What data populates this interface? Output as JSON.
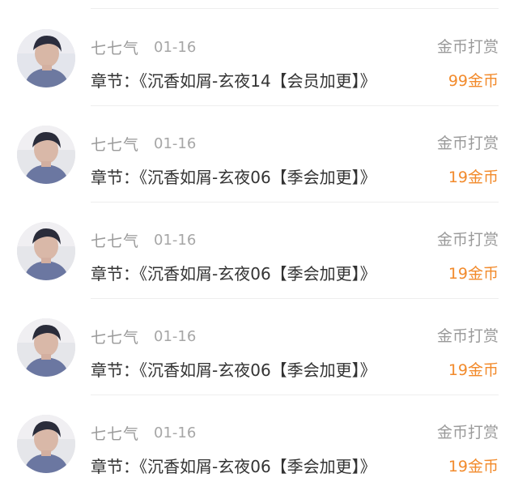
{
  "records": [
    {
      "user": "七七气",
      "date": "01-16",
      "type": "金币打赏",
      "chapter": "章节：《沉香如屑-玄夜14【会员加更】》",
      "amount": "99金币",
      "avatar_icon": "user-avatar-photo"
    },
    {
      "user": "七七气",
      "date": "01-16",
      "type": "金币打赏",
      "chapter": "章节：《沉香如屑-玄夜06【季会加更】》",
      "amount": "19金币",
      "avatar_icon": "user-avatar-photo"
    },
    {
      "user": "七七气",
      "date": "01-16",
      "type": "金币打赏",
      "chapter": "章节：《沉香如屑-玄夜06【季会加更】》",
      "amount": "19金币",
      "avatar_icon": "user-avatar-photo"
    },
    {
      "user": "七七气",
      "date": "01-16",
      "type": "金币打赏",
      "chapter": "章节：《沉香如屑-玄夜06【季会加更】》",
      "amount": "19金币",
      "avatar_icon": "user-avatar-photo"
    },
    {
      "user": "七七气",
      "date": "01-16",
      "type": "金币打赏",
      "chapter": "章节：《沉香如屑-玄夜06【季会加更】》",
      "amount": "19金币",
      "avatar_icon": "user-avatar-photo"
    }
  ],
  "colors": {
    "amount_orange": "#f28a2b",
    "secondary_gray": "#9a9a9a",
    "primary_text": "#333333",
    "divider": "#eeeeee"
  }
}
